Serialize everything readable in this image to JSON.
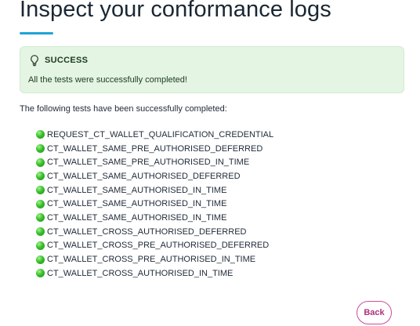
{
  "page": {
    "title": "Inspect your conformance logs"
  },
  "alert": {
    "icon": "lightbulb-icon",
    "title": "SUCCESS",
    "message": "All the tests were successfully completed!"
  },
  "intro": "The following tests have been successfully completed:",
  "tests": [
    {
      "name": "REQUEST_CT_WALLET_QUALIFICATION_CREDENTIAL",
      "status": "success"
    },
    {
      "name": "CT_WALLET_SAME_PRE_AUTHORISED_DEFERRED",
      "status": "success"
    },
    {
      "name": "CT_WALLET_SAME_PRE_AUTHORISED_IN_TIME",
      "status": "success"
    },
    {
      "name": "CT_WALLET_SAME_AUTHORISED_DEFERRED",
      "status": "success"
    },
    {
      "name": "CT_WALLET_SAME_AUTHORISED_IN_TIME",
      "status": "success"
    },
    {
      "name": "CT_WALLET_SAME_AUTHORISED_IN_TIME",
      "status": "success"
    },
    {
      "name": "CT_WALLET_SAME_AUTHORISED_IN_TIME",
      "status": "success"
    },
    {
      "name": "CT_WALLET_CROSS_AUTHORISED_DEFERRED",
      "status": "success"
    },
    {
      "name": "CT_WALLET_CROSS_PRE_AUTHORISED_DEFERRED",
      "status": "success"
    },
    {
      "name": "CT_WALLET_CROSS_PRE_AUTHORISED_IN_TIME",
      "status": "success"
    },
    {
      "name": "CT_WALLET_CROSS_AUTHORISED_IN_TIME",
      "status": "success"
    }
  ],
  "actions": {
    "back_label": "Back"
  },
  "colors": {
    "accent": "#1fa4d6",
    "success_bg": "#e4f5e3",
    "success_dot": "#39c12c",
    "back_button": "#c94f98"
  }
}
